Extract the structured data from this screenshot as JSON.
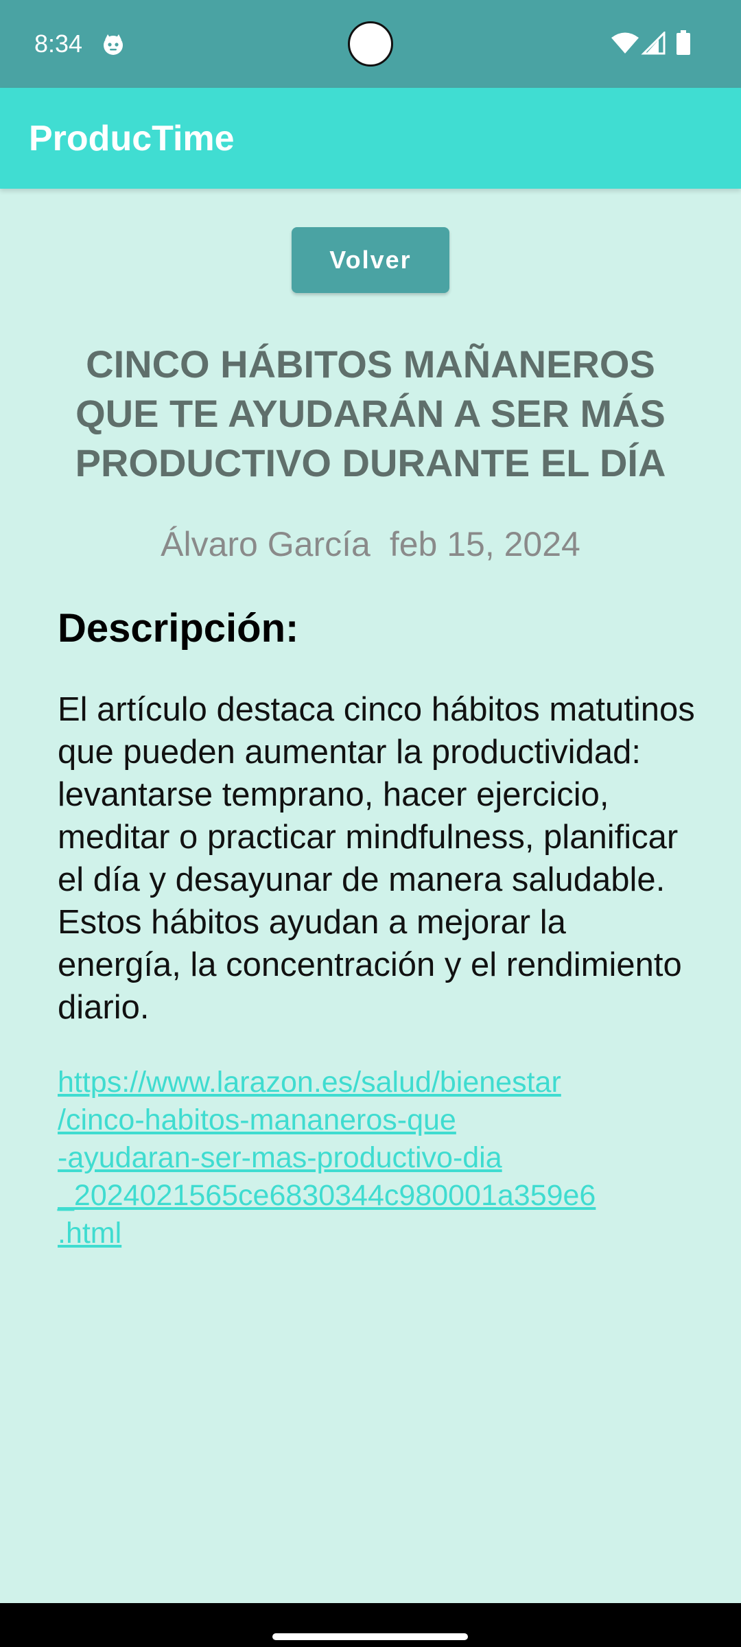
{
  "status_bar": {
    "time": "8:34",
    "app_icon": "cat-face-icon",
    "wifi_icon": "wifi-icon",
    "signal_icon": "cell-signal-icon",
    "battery_icon": "battery-icon",
    "background_color": "#4aa3a3"
  },
  "app_bar": {
    "title": "ProducTime",
    "background_color": "#40ddd2"
  },
  "actions": {
    "back_label": "Volver"
  },
  "article": {
    "title": "CINCO HÁBITOS MAÑANEROS QUE TE AYUDARÁN A SER MÁS PRODUCTIVO DURANTE EL DÍA",
    "author": "Álvaro García",
    "date": "feb 15, 2024",
    "description_heading": "Descripción:",
    "description": "El artículo destaca cinco hábitos matutinos que pueden aumentar la productividad: levantarse temprano, hacer ejercicio, meditar o practicar mindfulness, planificar el día y desayunar de manera saludable. Estos hábitos ayudan a mejorar la energía, la concentración y el rendimiento diario.",
    "link_lines": [
      "https://www.larazon.es/salud/bienestar",
      "/cinco-habitos-mananeros-que",
      "-ayudaran-ser-mas-productivo-dia",
      "_2024021565ce6830344c980001a359e6",
      ".html"
    ]
  },
  "colors": {
    "page_background": "#d0f2ea",
    "button": "#4aa3a3",
    "title_text": "#5f6f6b",
    "link": "#3fdcd0"
  }
}
